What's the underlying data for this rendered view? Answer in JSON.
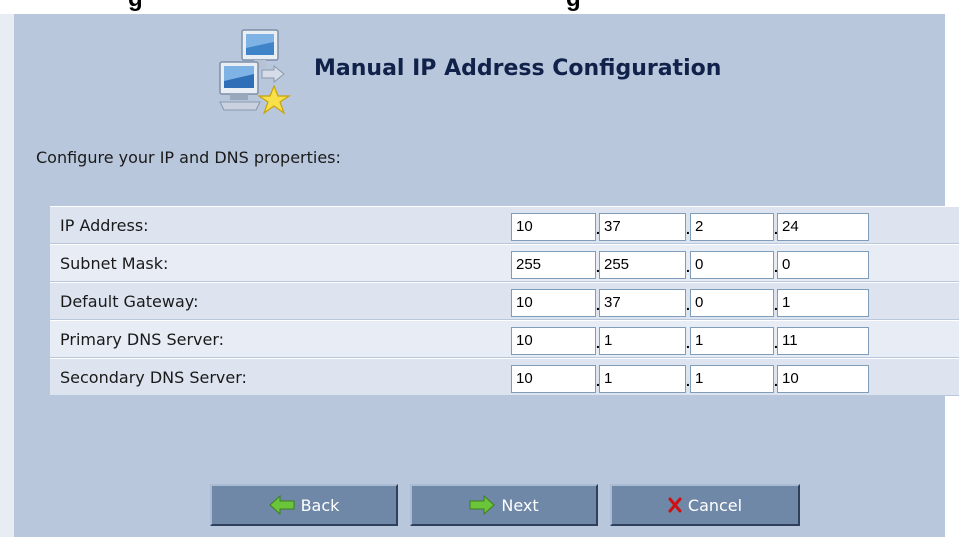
{
  "header": {
    "title": "Manual IP Address Configuration",
    "top_text_left": "g",
    "top_text_right": "g"
  },
  "intro": "Configure your IP and DNS properties:",
  "fields": [
    {
      "label": "IP Address:",
      "octets": [
        "10",
        "37",
        "2",
        "24"
      ]
    },
    {
      "label": "Subnet Mask:",
      "octets": [
        "255",
        "255",
        "0",
        "0"
      ]
    },
    {
      "label": "Default Gateway:",
      "octets": [
        "10",
        "37",
        "0",
        "1"
      ]
    },
    {
      "label": "Primary DNS Server:",
      "octets": [
        "10",
        "1",
        "1",
        "11"
      ]
    },
    {
      "label": "Secondary DNS Server:",
      "octets": [
        "10",
        "1",
        "1",
        "10"
      ]
    }
  ],
  "separator": ".",
  "buttons": {
    "back": "Back",
    "next": "Next",
    "cancel": "Cancel"
  },
  "icons": {
    "header": "network-computers-icon",
    "back": "green-arrow-left-icon",
    "next": "green-arrow-right-icon",
    "cancel": "red-x-icon"
  },
  "colors": {
    "panel_bg": "#b8c7dc",
    "row_bg": "#dde4f0",
    "title_color": "#10224a",
    "button_bg": "#6f88a8",
    "arrow_green": "#6bc53a",
    "cancel_red": "#d01010"
  }
}
